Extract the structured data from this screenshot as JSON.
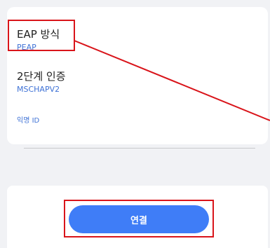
{
  "settings": {
    "eap_method": {
      "title": "EAP 방식",
      "value": "PEAP"
    },
    "phase2_auth": {
      "title": "2단계 인증",
      "value": "MSCHAPV2"
    },
    "anonymous_id": {
      "label": "익명 ID",
      "value": ""
    }
  },
  "actions": {
    "connect_label": "연결"
  },
  "colors": {
    "accent": "#3f7df7",
    "value_text": "#3f72d6",
    "highlight": "#d9141a",
    "background": "#f1f2f5"
  }
}
